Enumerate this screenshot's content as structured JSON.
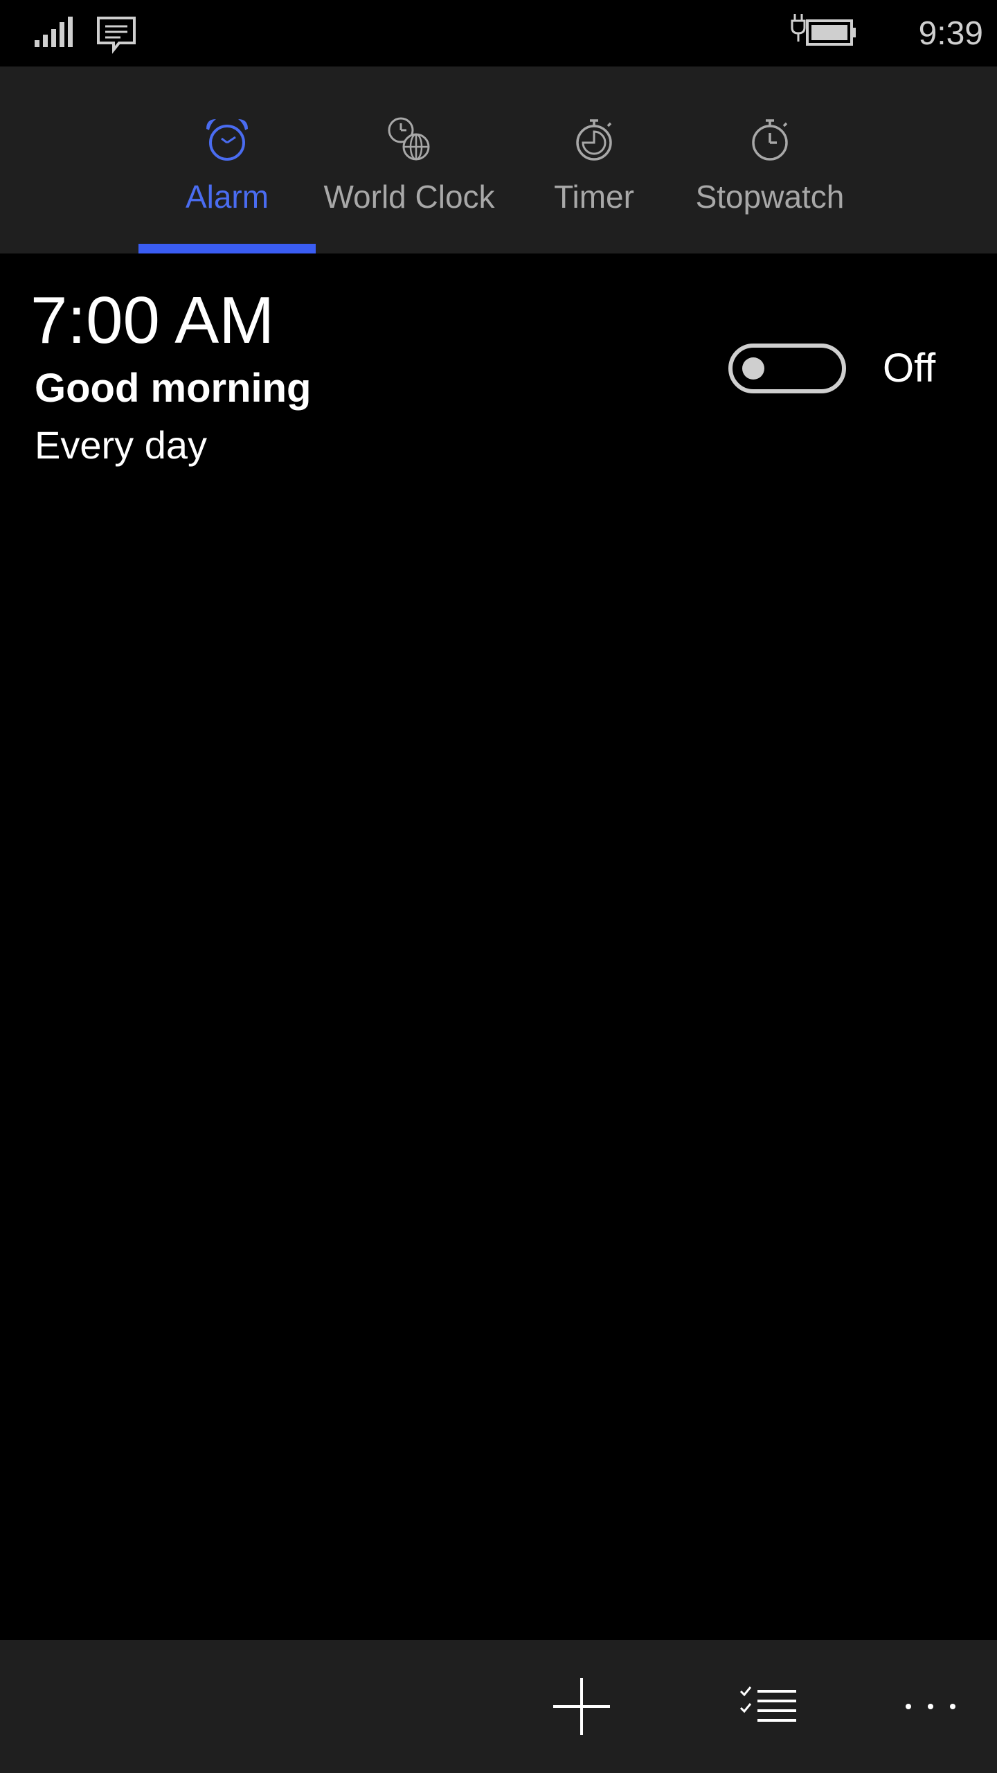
{
  "status_bar": {
    "time": "9:39",
    "signal_icon": "signal-strength-icon",
    "message_icon": "message-notification-icon",
    "battery_icon": "battery-charging-icon"
  },
  "tabs": [
    {
      "label": "Alarm",
      "icon": "alarm-clock-icon",
      "active": true
    },
    {
      "label": "World Clock",
      "icon": "world-clock-icon",
      "active": false
    },
    {
      "label": "Timer",
      "icon": "timer-icon",
      "active": false
    },
    {
      "label": "Stopwatch",
      "icon": "stopwatch-icon",
      "active": false
    }
  ],
  "alarms": [
    {
      "time": "7:00 AM",
      "name": "Good morning",
      "repeat": "Every day",
      "enabled": false,
      "state_label": "Off"
    }
  ],
  "app_bar": {
    "buttons": [
      {
        "icon": "add-icon"
      },
      {
        "icon": "select-list-icon"
      },
      {
        "icon": "more-options-icon"
      }
    ]
  },
  "colors": {
    "accent": "#3a5df3",
    "accent_text": "#4a6cf0",
    "background": "#000000",
    "header_background": "#1f1f1f",
    "inactive_text": "#a8a8a8"
  }
}
